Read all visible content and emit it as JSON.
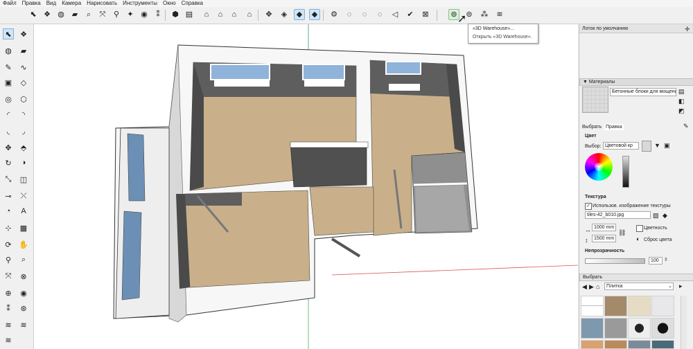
{
  "menu": [
    "Файл",
    "Правка",
    "Вид",
    "Камера",
    "Нарисовать",
    "Инструменты",
    "Окно",
    "Справка"
  ],
  "tooltip": {
    "title": "«3D Warehouse»...",
    "description": "Открыть «3D Warehouse»."
  },
  "tray": {
    "title": "Лоток по умолчанию",
    "materials_header": "▼ Материалы",
    "material_name": "Бетонные блоки для мощени",
    "tabs": {
      "select": "Выбрать",
      "edit": "Правка"
    },
    "color": {
      "header": "Цвет",
      "picker_label": "Выбор:",
      "picker_value": "Цветовой кр"
    },
    "texture": {
      "header": "Текстура",
      "use_image_label": "Использов. изображение текстуры",
      "file_name": "tiles-42_b010.jpg",
      "width": "1000 mm",
      "height": "1500 mm",
      "colorize_label": "Цветность",
      "reset_label": "Сброс цвета"
    },
    "opacity": {
      "header": "Непрозрачность",
      "value": "100"
    },
    "select_section": {
      "header": "Выбрать",
      "library": "Плитка"
    }
  },
  "colors": {
    "floor": "#c9b08a",
    "wall_top": "#ffffff",
    "wall_inner": "#5e5e5e",
    "accent": "#2f7fc3"
  }
}
